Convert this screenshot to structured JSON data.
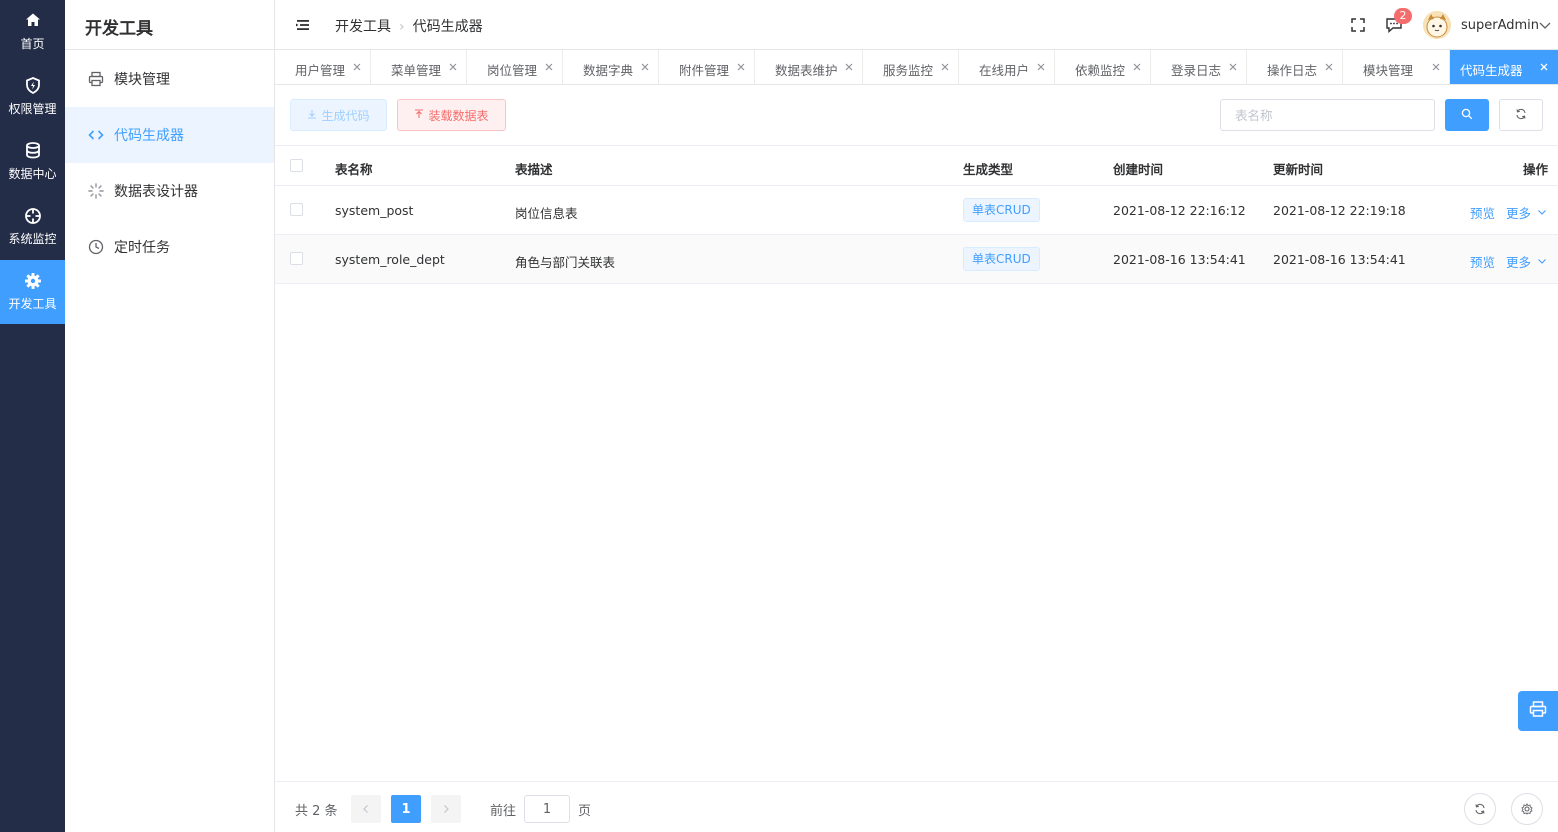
{
  "rail": {
    "items": [
      {
        "label": "首页",
        "icon": "home-icon"
      },
      {
        "label": "权限管理",
        "icon": "shield-icon"
      },
      {
        "label": "数据中心",
        "icon": "database-icon"
      },
      {
        "label": "系统监控",
        "icon": "crosshair-icon"
      },
      {
        "label": "开发工具",
        "icon": "gear-icon",
        "active": true
      }
    ]
  },
  "submenu": {
    "title": "开发工具",
    "items": [
      {
        "label": "模块管理",
        "icon": "printer-icon"
      },
      {
        "label": "代码生成器",
        "icon": "code-icon",
        "active": true
      },
      {
        "label": "数据表设计器",
        "icon": "loading-icon"
      },
      {
        "label": "定时任务",
        "icon": "clock-icon"
      }
    ]
  },
  "header": {
    "breadcrumb": [
      "开发工具",
      "代码生成器"
    ],
    "message_count": "2",
    "username": "superAdmin"
  },
  "tabs": [
    {
      "label": "用户管理"
    },
    {
      "label": "菜单管理"
    },
    {
      "label": "岗位管理"
    },
    {
      "label": "数据字典"
    },
    {
      "label": "附件管理"
    },
    {
      "label": "数据表维护"
    },
    {
      "label": "服务监控"
    },
    {
      "label": "在线用户"
    },
    {
      "label": "依赖监控"
    },
    {
      "label": "登录日志"
    },
    {
      "label": "操作日志"
    },
    {
      "label": "模块管理"
    },
    {
      "label": "代码生成器",
      "active": true
    }
  ],
  "toolbar": {
    "generate_label": "生成代码",
    "load_label": "装载数据表",
    "search_placeholder": "表名称",
    "search_value": ""
  },
  "table": {
    "columns": [
      "表名称",
      "表描述",
      "生成类型",
      "创建时间",
      "更新时间",
      "操作"
    ],
    "rows": [
      {
        "name": "system_post",
        "desc": "岗位信息表",
        "type": "单表CRUD",
        "created": "2021-08-12 22:16:12",
        "updated": "2021-08-12 22:19:18",
        "preview": "预览",
        "more": "更多"
      },
      {
        "name": "system_role_dept",
        "desc": "角色与部门关联表",
        "type": "单表CRUD",
        "created": "2021-08-16 13:54:41",
        "updated": "2021-08-16 13:54:41",
        "preview": "预览",
        "more": "更多"
      }
    ]
  },
  "pagination": {
    "total_text": "共 2 条",
    "current_page": "1",
    "goto_label": "前往",
    "goto_value": "1",
    "page_suffix": "页"
  },
  "colors": {
    "primary": "#409eff",
    "rail_bg": "#232d48",
    "danger": "#f56c6c"
  }
}
